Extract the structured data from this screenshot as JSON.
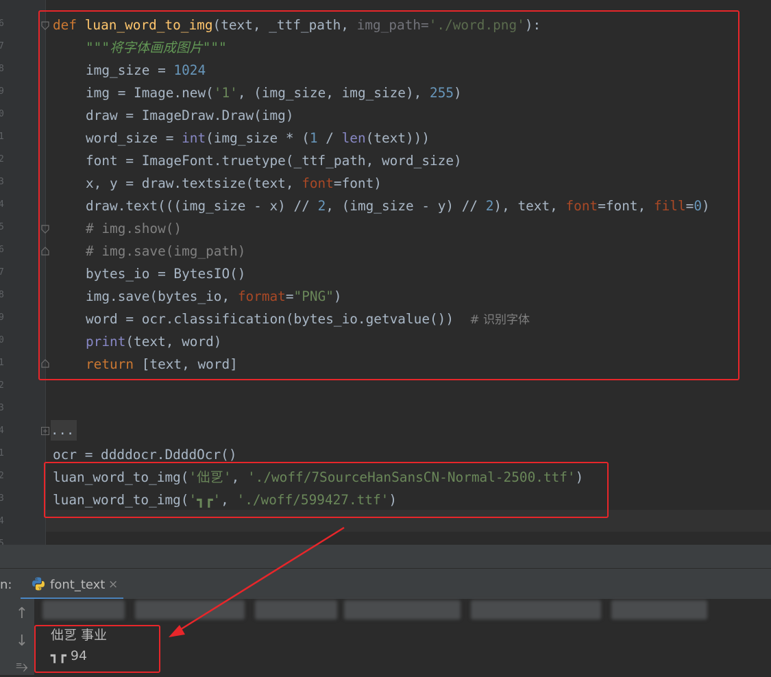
{
  "line_numbers": [
    "6",
    "7",
    "8",
    "9",
    "0",
    "1",
    "2",
    "3",
    "4",
    "5",
    "6",
    "7",
    "8",
    "9",
    "0",
    "1",
    "2",
    "3",
    "4",
    "1",
    "2",
    "3",
    "4",
    "5"
  ],
  "code": {
    "l1": {
      "kw": "def",
      "name": "luan_word_to_img",
      "open": "(text, _ttf_path, ",
      "param_dim": "img_path=",
      "default": "'./word.png'",
      "close": "):"
    },
    "l2": {
      "doc": "\"\"\"将字体画成图片\"\"\""
    },
    "l3": {
      "a": "img_size = ",
      "n": "1024"
    },
    "l4": {
      "a": "img = Image.new(",
      "s": "'1'",
      "b": ", (img_size, img_size), ",
      "n": "255",
      "c": ")"
    },
    "l5": {
      "a": "draw = ImageDraw.Draw(img)"
    },
    "l6": {
      "a": "word_size = ",
      "bi1": "int",
      "b": "(img_size * (",
      "n": "1",
      "c": " / ",
      "bi2": "len",
      "d": "(text)))"
    },
    "l7": {
      "a": "font = ImageFont.truetype(_ttf_path, word_size)"
    },
    "l8": {
      "a": "x, y = draw.textsize(text, ",
      "p": "font",
      "b": "=font)"
    },
    "l9": {
      "a": "draw.text(((img_size - x) // ",
      "n1": "2",
      "b": ", (img_size - y) // ",
      "n2": "2",
      "c": "), text, ",
      "p1": "font",
      "d": "=font, ",
      "p2": "fill",
      "e": "=",
      "n3": "0",
      "f": ")"
    },
    "l10": {
      "cm": "# img.show()"
    },
    "l11": {
      "cm": "# img.save(img_path)"
    },
    "l12": {
      "a": "bytes_io = BytesIO()"
    },
    "l13": {
      "a": "img.save(bytes_io, ",
      "p": "format",
      "b": "=",
      "s": "\"PNG\"",
      "c": ")"
    },
    "l14": {
      "a": "word = ocr.classification(bytes_io.getvalue())  ",
      "cm": "# 识别字体"
    },
    "l15": {
      "bi": "print",
      "a": "(text, word)"
    },
    "l16": {
      "kw": "return",
      "a": " [text, word]"
    },
    "collapsed": "...",
    "l17": {
      "a": "ocr = ddddocr.DdddOcr()"
    },
    "l18": {
      "a": "luan_word_to_img(",
      "s1": "'㑁㐓'",
      "b": ", ",
      "s2": "'./woff/7SourceHanSansCN-Normal-2500.ttf'",
      "c": ")"
    },
    "l19": {
      "a": "luan_word_to_img(",
      "s1": "'┓┏'",
      "b": ", ",
      "s2": "'./woff/599427.ttf'",
      "c": ")"
    }
  },
  "run_panel": {
    "label": "n:",
    "tab_label": "font_text",
    "tab_close": "×",
    "tools": [
      "↑",
      "↓",
      "⥱"
    ],
    "output": [
      "㑁㐓 事业",
      "┓┏ 94"
    ]
  },
  "colors": {
    "highlight": "#e8262a",
    "accent": "#4a88c7"
  },
  "icons": {
    "tab": "python-icon",
    "fold": "fold-marker-icon"
  }
}
